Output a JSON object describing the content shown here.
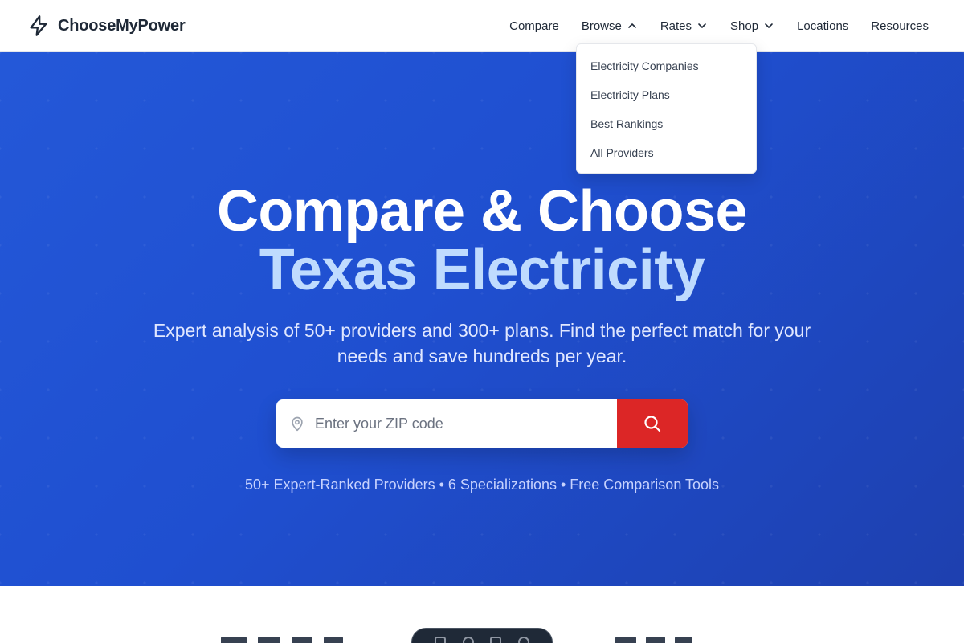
{
  "brand": {
    "name": "ChooseMyPower",
    "icon": "lightning-bolt-icon"
  },
  "nav": {
    "items": [
      {
        "label": "Compare",
        "has_chevron": false
      },
      {
        "label": "Browse",
        "has_chevron": true,
        "expanded": true
      },
      {
        "label": "Rates",
        "has_chevron": true
      },
      {
        "label": "Shop",
        "has_chevron": true
      },
      {
        "label": "Locations",
        "has_chevron": false
      },
      {
        "label": "Resources",
        "has_chevron": false
      }
    ]
  },
  "browse_menu": {
    "items": [
      "Electricity Companies",
      "Electricity Plans",
      "Best Rankings",
      "All Providers"
    ]
  },
  "hero": {
    "title_line1": "Compare & Choose",
    "title_line2": "Texas Electricity",
    "subtitle": "Expert analysis of 50+ providers and 300+ plans. Find the perfect match for your needs and save hundreds per year.",
    "stats": "50+ Expert-Ranked Providers • 6 Specializations • Free Comparison Tools"
  },
  "search": {
    "placeholder": "Enter your ZIP code",
    "value": "",
    "pin_icon": "map-pin-icon",
    "button_icon": "search-icon"
  },
  "colors": {
    "hero_start": "#2458d8",
    "hero_end": "#1e40af",
    "title_accent": "#bfdbfe",
    "search_button": "#dc2626"
  }
}
